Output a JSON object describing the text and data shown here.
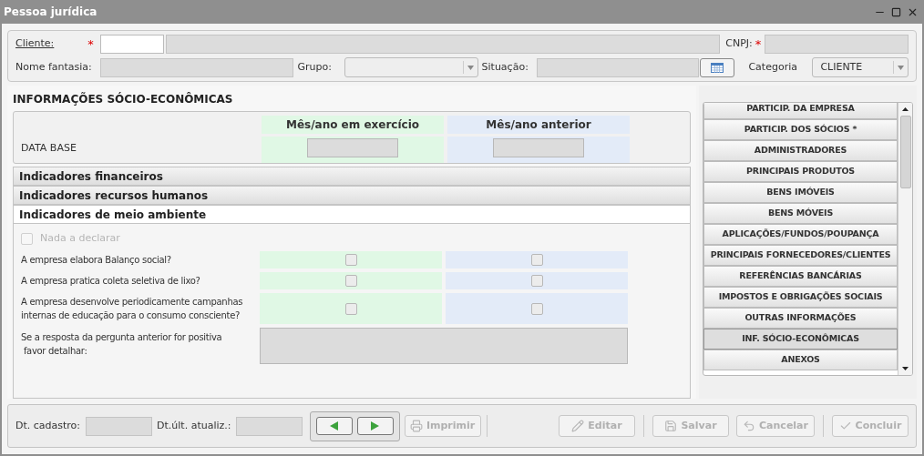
{
  "window": {
    "title": "Pessoa jurídica"
  },
  "header": {
    "cliente_label": "Cliente:",
    "cliente_required": "*",
    "cnpj_label": "CNPJ:",
    "cnpj_required": "*",
    "nome_fantasia_label": "Nome fantasia:",
    "grupo_label": "Grupo:",
    "situacao_label": "Situação:",
    "categoria_label": "Categoria",
    "categoria_value": "CLIENTE"
  },
  "section": {
    "title": "INFORMAÇÕES SÓCIO-ECONÔMICAS",
    "columns": [
      "Mês/ano em exercício",
      "Mês/ano anterior"
    ],
    "data_base_label": "DATA BASE"
  },
  "accordion": [
    {
      "label": "Indicadores financeiros",
      "expanded": false
    },
    {
      "label": "Indicadores recursos humanos",
      "expanded": false
    },
    {
      "label": "Indicadores de meio ambiente",
      "expanded": true
    }
  ],
  "nada_a_declarar": {
    "label": "Nada a declarar",
    "checked": false,
    "disabled": true
  },
  "questions": [
    {
      "text": "A empresa elabora Balanço social?",
      "current_checked": false,
      "previous_checked": false
    },
    {
      "text": "A empresa pratica coleta seletiva de lixo?",
      "current_checked": false,
      "previous_checked": false
    },
    {
      "text": "A empresa desenvolve periodicamente campanhas\ninternas de educação para o consumo consciente?",
      "current_checked": false,
      "previous_checked": false
    }
  ],
  "detail_label": "Se a resposta da pergunta anterior for positiva\n favor detalhar:",
  "side_menu": [
    {
      "label": "PARTICIP. DA EMPRESA",
      "selected": false
    },
    {
      "label": "PARTICIP. DOS SÓCIOS *",
      "selected": false
    },
    {
      "label": "ADMINISTRADORES",
      "selected": false
    },
    {
      "label": "PRINCIPAIS PRODUTOS",
      "selected": false
    },
    {
      "label": "BENS IMÓVEIS",
      "selected": false
    },
    {
      "label": "BENS MÓVEIS",
      "selected": false
    },
    {
      "label": "APLICAÇÕES/FUNDOS/POUPANÇA",
      "selected": false
    },
    {
      "label": "PRINCIPAIS FORNECEDORES/CLIENTES",
      "selected": false
    },
    {
      "label": "REFERÊNCIAS BANCÁRIAS",
      "selected": false
    },
    {
      "label": "IMPOSTOS E OBRIGAÇÕES SOCIAIS",
      "selected": false
    },
    {
      "label": "OUTRAS INFORMAÇÕES",
      "selected": false
    },
    {
      "label": "INF. SÓCIO-ECONÔMICAS",
      "selected": true
    },
    {
      "label": "ANEXOS",
      "selected": false
    }
  ],
  "footer": {
    "dt_cadastro_label": "Dt. cadastro:",
    "dt_atualiz_label": "Dt.últ. atualiz.:",
    "buttons": [
      {
        "kind": "print",
        "label": "Imprimir",
        "disabled": true
      },
      {
        "kind": "edit",
        "label": "Editar",
        "disabled": true
      },
      {
        "kind": "save",
        "label": "Salvar",
        "disabled": true
      },
      {
        "kind": "cancel",
        "label": "Cancelar",
        "disabled": true
      },
      {
        "kind": "finish",
        "label": "Concluir",
        "disabled": true
      }
    ]
  }
}
